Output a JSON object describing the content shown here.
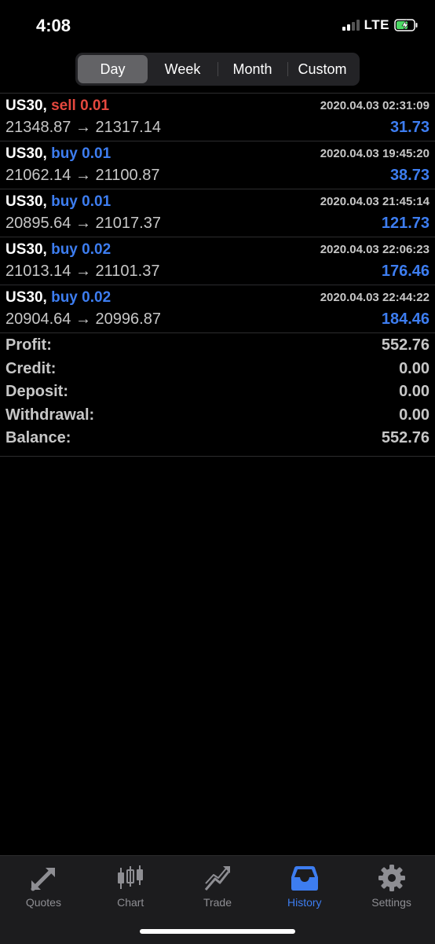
{
  "status_bar": {
    "time": "4:08",
    "network": "LTE",
    "signal_icon": "cellular-signal-icon",
    "battery_icon": "battery-charging-icon",
    "battery_color": "#4cd964"
  },
  "period_tabs": {
    "items": [
      {
        "label": "Day",
        "active": true
      },
      {
        "label": "Week",
        "active": false
      },
      {
        "label": "Month",
        "active": false
      },
      {
        "label": "Custom",
        "active": false
      }
    ]
  },
  "deals": [
    {
      "symbol": "US30,",
      "type": "sell 0.01",
      "direction": "sell",
      "time": "2020.04.03 02:31:09",
      "prices": "21348.87 → 21317.14",
      "profit": "31.73"
    },
    {
      "symbol": "US30,",
      "type": "buy 0.01",
      "direction": "buy",
      "time": "2020.04.03 19:45:20",
      "prices": "21062.14 → 21100.87",
      "profit": "38.73"
    },
    {
      "symbol": "US30,",
      "type": "buy 0.01",
      "direction": "buy",
      "time": "2020.04.03 21:45:14",
      "prices": "20895.64 → 21017.37",
      "profit": "121.73"
    },
    {
      "symbol": "US30,",
      "type": "buy 0.02",
      "direction": "buy",
      "time": "2020.04.03 22:06:23",
      "prices": "21013.14 → 21101.37",
      "profit": "176.46"
    },
    {
      "symbol": "US30,",
      "type": "buy 0.02",
      "direction": "buy",
      "time": "2020.04.03 22:44:22",
      "prices": "20904.64 → 20996.87",
      "profit": "184.46"
    }
  ],
  "summary": [
    {
      "label": "Profit:",
      "value": "552.76"
    },
    {
      "label": "Credit:",
      "value": "0.00"
    },
    {
      "label": "Deposit:",
      "value": "0.00"
    },
    {
      "label": "Withdrawal:",
      "value": "0.00"
    },
    {
      "label": "Balance:",
      "value": "552.76"
    }
  ],
  "tab_bar": {
    "items": [
      {
        "label": "Quotes",
        "icon": "quotes-arrows-icon",
        "active": false
      },
      {
        "label": "Chart",
        "icon": "candlestick-chart-icon",
        "active": false
      },
      {
        "label": "Trade",
        "icon": "trade-trend-icon",
        "active": false
      },
      {
        "label": "History",
        "icon": "inbox-tray-icon",
        "active": true
      },
      {
        "label": "Settings",
        "icon": "gear-icon",
        "active": false
      }
    ]
  },
  "colors": {
    "accent": "#3d7df0",
    "sell": "#e5483e",
    "inactive": "#8e8e93"
  }
}
